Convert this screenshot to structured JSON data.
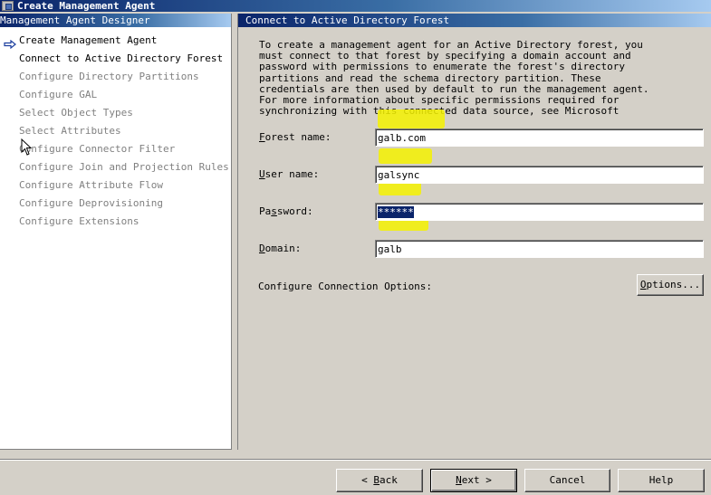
{
  "window": {
    "title": "Create Management Agent"
  },
  "designer": {
    "header": "Management Agent Designer",
    "steps": [
      {
        "label": "Create Management Agent",
        "enabled": true
      },
      {
        "label": "Connect to Active Directory Forest",
        "enabled": true,
        "current": true
      },
      {
        "label": "Configure Directory Partitions",
        "enabled": false
      },
      {
        "label": "Configure GAL",
        "enabled": false
      },
      {
        "label": "Select Object Types",
        "enabled": false
      },
      {
        "label": "Select Attributes",
        "enabled": false
      },
      {
        "label": "Configure Connector Filter",
        "enabled": false
      },
      {
        "label": "Configure Join and Projection Rules",
        "enabled": false
      },
      {
        "label": "Configure Attribute Flow",
        "enabled": false
      },
      {
        "label": "Configure Deprovisioning",
        "enabled": false
      },
      {
        "label": "Configure Extensions",
        "enabled": false
      }
    ]
  },
  "page": {
    "header": "Connect to Active Directory Forest",
    "description": "To create a management agent for an Active Directory forest, you\nmust connect to that forest by specifying a domain account and\npassword with permissions to enumerate the forest's directory\npartitions and read the schema directory partition. These\ncredentials are then used by default to run the management agent.\nFor more information about specific permissions required for\nsynchronizing with this connected data source, see Microsoft"
  },
  "form": {
    "forest": {
      "label_key": "F",
      "label_rest": "orest name:",
      "value": "galb.com"
    },
    "user": {
      "label_key": "U",
      "label_rest": "ser name:",
      "value": "galsync"
    },
    "password": {
      "label_pre": "Pa",
      "label_key": "s",
      "label_rest": "sword:",
      "value": "******"
    },
    "domain": {
      "label_key": "D",
      "label_rest": "omain:",
      "value": "galb"
    },
    "connection_options_label": "Configure Connection Options:",
    "options_button": {
      "key": "O",
      "rest": "ptions..."
    }
  },
  "footer": {
    "back": {
      "prefix": "<  ",
      "key": "B",
      "rest": "ack"
    },
    "next": {
      "key": "N",
      "rest": "ext  >"
    },
    "cancel": "Cancel",
    "help": "Help"
  },
  "colors": {
    "title_blue": "#0a246a",
    "highlight_yellow": "#f5f200",
    "dialog_gray": "#d4d0c8"
  }
}
